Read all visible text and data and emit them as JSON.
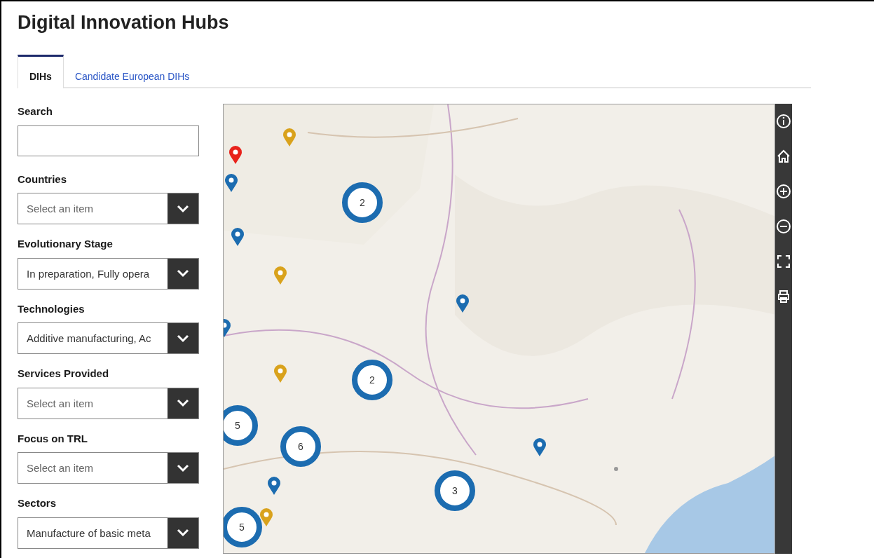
{
  "title": "Digital Innovation Hubs",
  "tabs": [
    {
      "label": "DIHs",
      "selected": true
    },
    {
      "label": "Candidate European DIHs",
      "selected": false
    }
  ],
  "search": {
    "label": "Search"
  },
  "filters": [
    {
      "label": "Countries",
      "placeholder": "Select an item"
    },
    {
      "label": "Evolutionary Stage",
      "value": "In preparation, Fully opera"
    },
    {
      "label": "Technologies",
      "value": "Additive manufacturing, Ac"
    },
    {
      "label": "Services Provided",
      "placeholder": "Select an item"
    },
    {
      "label": "Focus on TRL",
      "placeholder": "Select an item"
    },
    {
      "label": "Sectors",
      "value": "Manufacture of basic meta"
    }
  ],
  "map": {
    "kind": "picture",
    "markers": [
      {
        "kind": "pin",
        "color": "#e8221b"
      },
      {
        "kind": "pin",
        "color": "#d9a21c"
      },
      {
        "kind": "pin",
        "color": "#1c6cb0"
      },
      {
        "kind": "pin",
        "color": "#1c6cb0"
      },
      {
        "kind": "pin",
        "color": "#d9a21c"
      },
      {
        "kind": "pin",
        "color": "#1c6cb0"
      },
      {
        "kind": "pin",
        "color": "#d9a21c"
      },
      {
        "kind": "pin",
        "color": "#1c6cb0"
      },
      {
        "kind": "pin",
        "color": "#1c6cb0"
      },
      {
        "kind": "pin",
        "color": "#1c6cb0"
      },
      {
        "kind": "pin",
        "color": "#d9a21c"
      },
      {
        "kind": "cluster",
        "count": "2"
      },
      {
        "kind": "cluster",
        "count": "2"
      },
      {
        "kind": "cluster",
        "count": "6"
      },
      {
        "kind": "cluster",
        "count": "3"
      },
      {
        "kind": "cluster",
        "count": "5"
      },
      {
        "kind": "cluster",
        "count": "5"
      }
    ],
    "tools": [
      {
        "kind": "info"
      },
      {
        "kind": "home"
      },
      {
        "kind": "zoom-in"
      },
      {
        "kind": "zoom-out"
      },
      {
        "kind": "fullscreen"
      },
      {
        "kind": "print"
      }
    ]
  }
}
